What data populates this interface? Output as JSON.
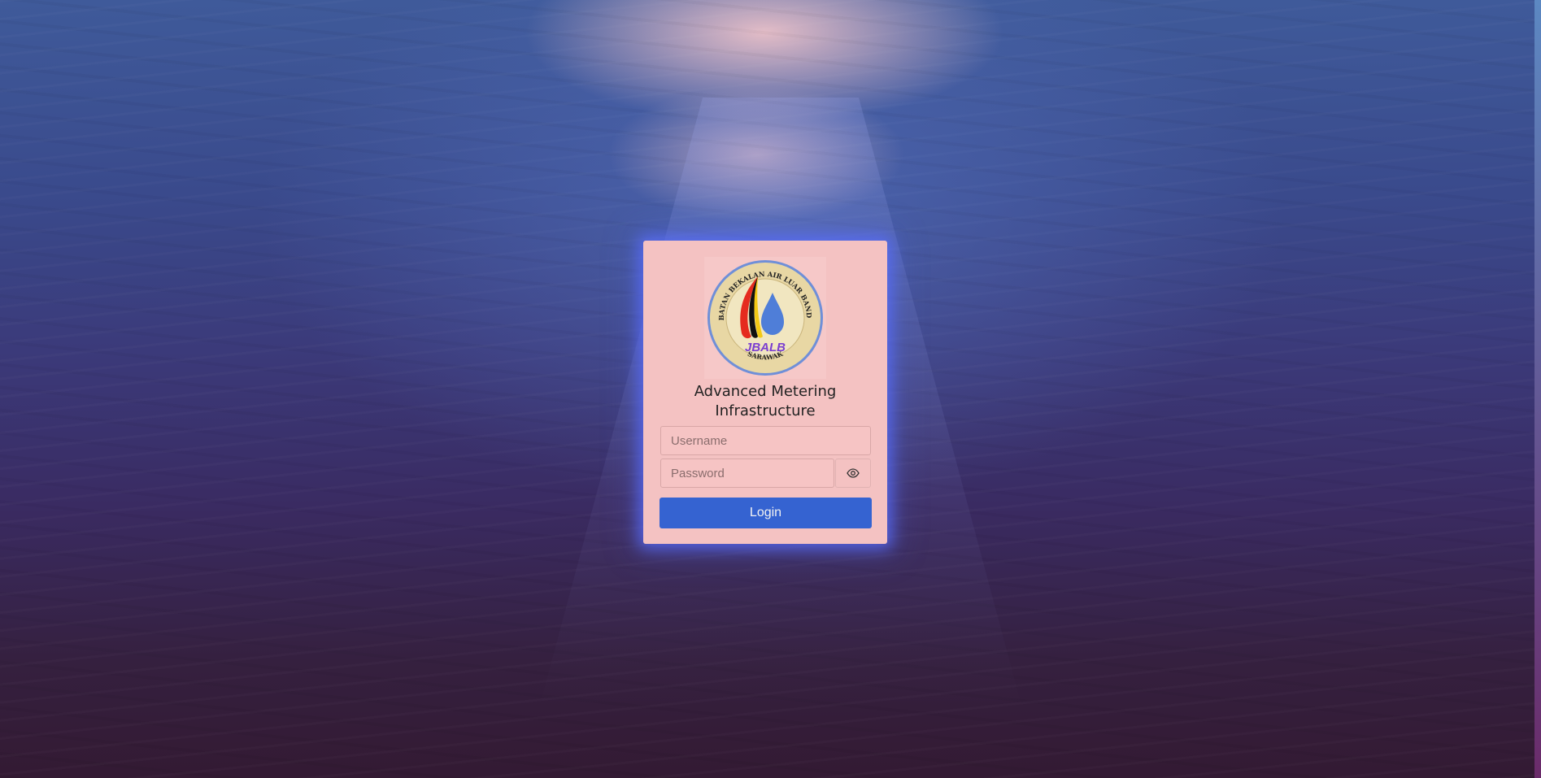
{
  "app": {
    "title": "Advanced Metering Infrastructure"
  },
  "logo": {
    "top_text": "JABATAN BEKALAN AIR LUAR BANDAR",
    "bottom_text": "SARAWAK",
    "acronym": "JBALB"
  },
  "login": {
    "username_placeholder": "Username",
    "password_placeholder": "Password",
    "login_label": "Login",
    "toggle_icon": "eye-icon"
  },
  "colors": {
    "card": "#f4c2c2",
    "login_button": "#3563d1",
    "glow": "#5a6eff"
  }
}
